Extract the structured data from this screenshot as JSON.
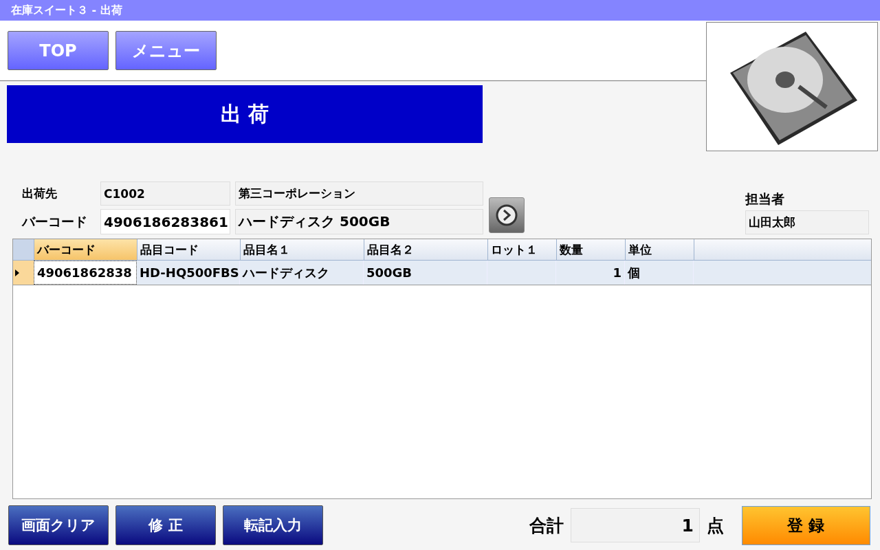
{
  "window": {
    "title": "在庫スイート３ - 出荷"
  },
  "nav_buttons": [
    {
      "label": "TOP"
    },
    {
      "label": "メニュー"
    }
  ],
  "banner": "出 荷",
  "form": {
    "destination": {
      "label": "出荷先",
      "code": "C1002",
      "name": "第三コーポレーション"
    },
    "barcode": {
      "label": "バーコード",
      "value": "4906186283861",
      "name": "ハードディスク 500GB"
    },
    "staff": {
      "label": "担当者",
      "value": "山田太郎"
    }
  },
  "table": {
    "columns": [
      {
        "label": "バーコード",
        "selected": true,
        "kind": "text"
      },
      {
        "label": "品目コード",
        "selected": false,
        "kind": "text"
      },
      {
        "label": "品目名１",
        "selected": false,
        "kind": "text"
      },
      {
        "label": "品目名２",
        "selected": false,
        "kind": "text"
      },
      {
        "label": "ロット１",
        "selected": false,
        "kind": "text"
      },
      {
        "label": "数量",
        "selected": false,
        "kind": "number"
      },
      {
        "label": "単位",
        "selected": false,
        "kind": "text"
      }
    ],
    "rows": [
      {
        "selected": true,
        "cells": [
          "49061862838",
          "HD-HQ500FBS",
          "ハードディスク",
          "500GB",
          null,
          "1",
          "個"
        ]
      }
    ]
  },
  "footer": {
    "buttons": [
      {
        "label": "画面クリア"
      },
      {
        "label": "修 正"
      },
      {
        "label": "転記入力"
      }
    ],
    "total_label": "合計",
    "total": "1",
    "unit": "点",
    "submit": "登 録"
  }
}
